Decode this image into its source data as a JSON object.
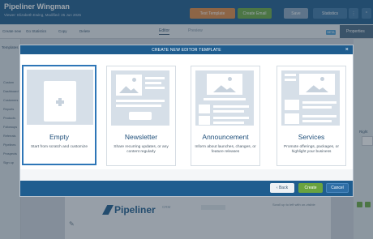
{
  "app": {
    "title": "Pipeliner Wingman",
    "subtitle": "Viewer: Elizabeth Ewing, Modified: 25 Jun 2025",
    "test_label": "Test Template",
    "create_email_label": "Create Email",
    "save_label": "Save",
    "statistics_label": "Statistics"
  },
  "toolbar": {
    "items": [
      "Create new",
      "Go Statistics",
      "Copy",
      "Delete"
    ],
    "tab_editor": "Editor",
    "tab_preview": "Preview",
    "badge": "BETA",
    "properties_label": "Properties"
  },
  "sidebar": {
    "title": "Templates",
    "items": [
      "Custom",
      "Dashboard",
      "Customers",
      "Reports",
      "Products",
      "Followups",
      "Referrals",
      "Pipelines",
      "Prospects",
      "Sign up"
    ]
  },
  "right_panel": {
    "label": "Right"
  },
  "canvas": {
    "logo_text": "Pipeliner",
    "logo_suffix": "CRM",
    "side_text": "Scroll up to left with un-visible"
  },
  "modal": {
    "title": "CREATE NEW EDITOR TEMPLATE",
    "close_label": "×",
    "cards": [
      {
        "title": "Empty",
        "description": "Start from scratch and customize"
      },
      {
        "title": "Newsletter",
        "description": "Share recurring updates, or any content regularly"
      },
      {
        "title": "Announcement",
        "description": "Inform about launches, changes, or feature releases"
      },
      {
        "title": "Services",
        "description": "Promote offerings, packages, or highlight your business"
      }
    ],
    "back_label": "‹ Back",
    "create_label": "Create",
    "cancel_label": "Cancel"
  },
  "colors": {
    "brand": "#1f5d8f",
    "accent_green": "#6aa33f",
    "selected_border": "#2e76b7"
  }
}
